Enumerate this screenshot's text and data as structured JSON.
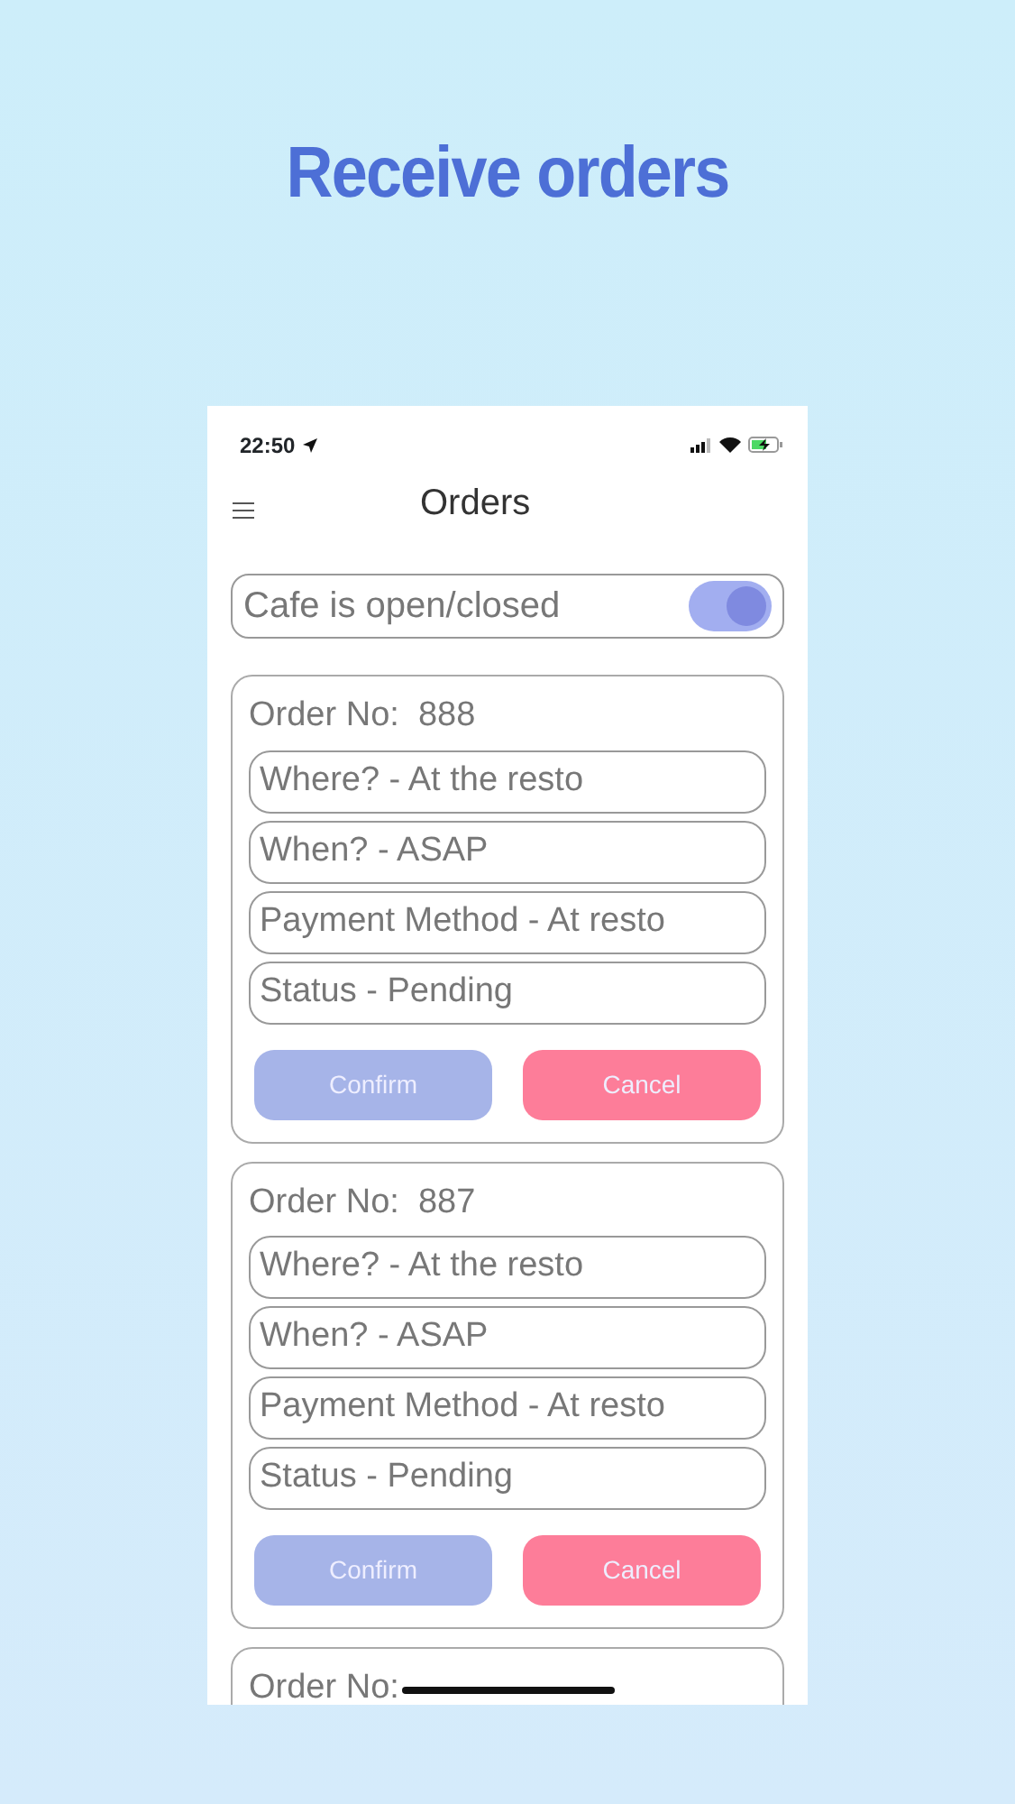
{
  "headline": "Receive orders",
  "status_bar": {
    "time": "22:50"
  },
  "app_bar": {
    "title": "Orders"
  },
  "cafe_toggle": {
    "label": "Cafe is open/closed",
    "on": true
  },
  "orders": [
    {
      "number": "Order No:  888",
      "fields": [
        "Where? - At the resto",
        "When? - ASAP",
        "Payment Method - At resto",
        "Status - Pending"
      ],
      "buttons": [
        {
          "label": "Confirm",
          "kind": "confirm"
        },
        {
          "label": "Cancel",
          "kind": "cancel"
        }
      ]
    },
    {
      "number": "Order No:  887",
      "fields": [
        "Where? - At the resto",
        "When? - ASAP",
        "Payment Method - At resto",
        "Status - Pending"
      ],
      "buttons": [
        {
          "label": "Confirm",
          "kind": "confirm"
        },
        {
          "label": "Cancel",
          "kind": "cancel"
        }
      ]
    },
    {
      "number": "Order No:"
    }
  ]
}
